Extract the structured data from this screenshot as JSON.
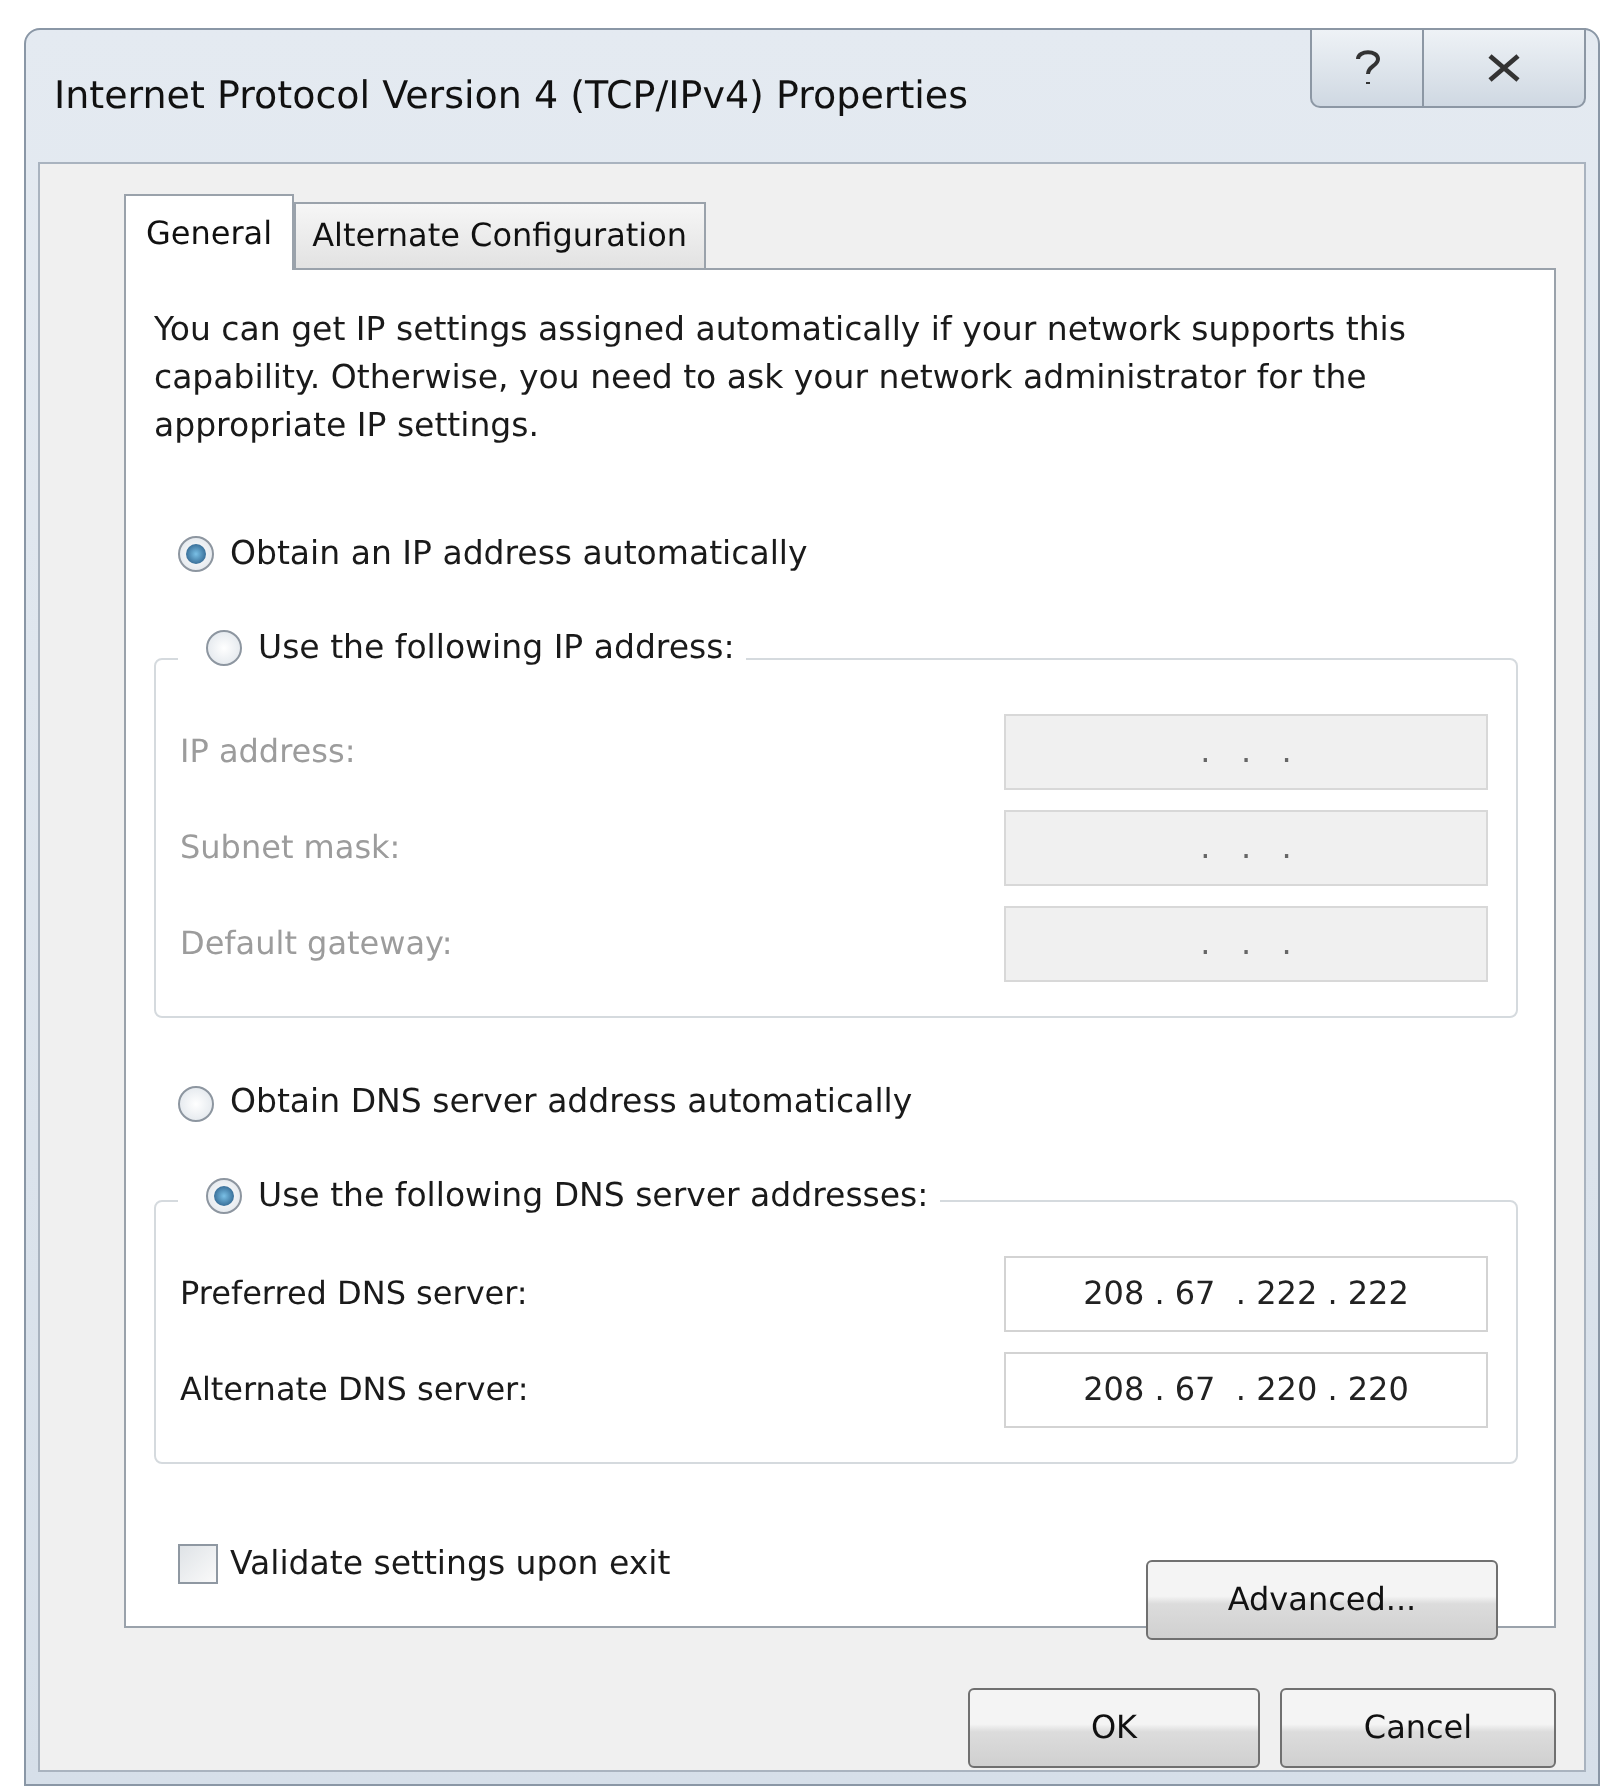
{
  "window": {
    "title": "Internet Protocol Version 4 (TCP/IPv4) Properties"
  },
  "tabs": [
    {
      "label": "General",
      "selected": true
    },
    {
      "label": "Alternate Configuration",
      "selected": false
    }
  ],
  "description": "You can get IP settings assigned automatically if your network supports this capability. Otherwise, you need to ask your network administrator for the appropriate IP settings.",
  "ip_options": [
    {
      "label": "Obtain an IP address automatically",
      "selected": true
    },
    {
      "label": "Use the following IP address:",
      "selected": false
    }
  ],
  "ip_fields": [
    {
      "label": "IP address:",
      "value": ".   .   .",
      "disabled": true
    },
    {
      "label": "Subnet mask:",
      "value": ".   .   .",
      "disabled": true
    },
    {
      "label": "Default gateway:",
      "value": ".   .   .",
      "disabled": true
    }
  ],
  "dns_options": [
    {
      "label": "Obtain DNS server address automatically",
      "selected": false
    },
    {
      "label": "Use the following DNS server addresses:",
      "selected": true
    }
  ],
  "dns_fields": [
    {
      "label": "Preferred DNS server:",
      "value": "208 . 67  . 222 . 222",
      "disabled": false
    },
    {
      "label": "Alternate DNS server:",
      "value": "208 . 67  . 220 . 220",
      "disabled": false
    }
  ],
  "validate": {
    "label": "Validate settings upon exit",
    "checked": false
  },
  "advanced_button": "Advanced...",
  "buttons": [
    "OK",
    "Cancel"
  ]
}
